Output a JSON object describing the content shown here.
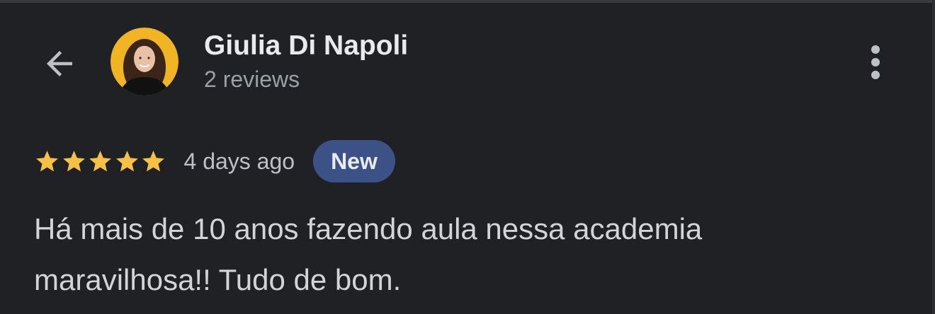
{
  "header": {
    "back_icon": "arrow-back-icon",
    "avatar_icon": "reviewer-photo",
    "reviewer_name": "Giulia Di Napoli",
    "review_count": "2 reviews",
    "more_icon": "more-vert-icon"
  },
  "review": {
    "rating": 5,
    "rating_max": 5,
    "date": "4 days ago",
    "badge": "New",
    "text": "Há mais de 10 anos fazendo aula nessa academia maravilhosa!! Tudo de bom."
  },
  "colors": {
    "background": "#202124",
    "star": "#f6c144",
    "badge_bg": "#3c5287",
    "primary_text": "#e8eaed",
    "secondary_text": "#9aa0a6"
  }
}
